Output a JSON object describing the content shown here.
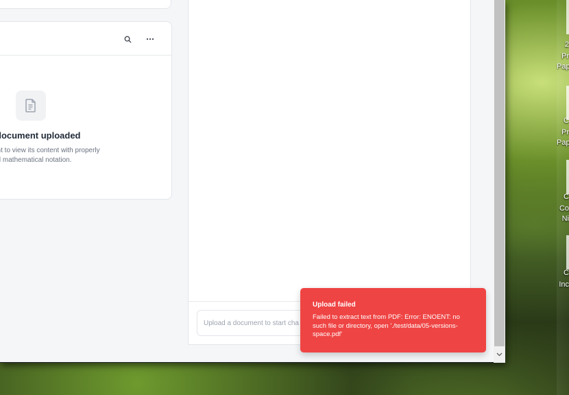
{
  "viewer": {
    "empty_title": "document uploaded",
    "empty_desc_line1": "ent to view its content with properly",
    "empty_desc_line2": "ed mathematical notation.",
    "icons": [
      "search-icon",
      "more-icon",
      "document-icon"
    ]
  },
  "chat": {
    "input_placeholder": "Upload a document to start cha"
  },
  "toast": {
    "title": "Upload failed",
    "message": "Failed to extract text from PDF: Error: ENOENT: no such file or directory, open './test/data/05-versions-space.pdf'",
    "color": "#ef4444"
  },
  "desktop": {
    "labels": [
      "2",
      "Pr",
      "Pap",
      "C",
      "Pr",
      "Pap",
      "C",
      "Co",
      "Ni",
      "C",
      "Inc"
    ]
  }
}
